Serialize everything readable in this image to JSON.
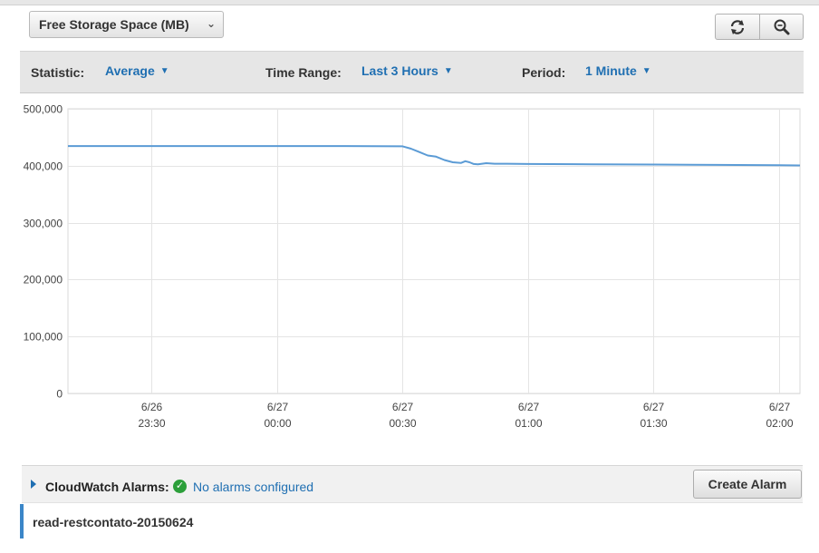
{
  "metric_select": {
    "label": "Free Storage Space (MB)",
    "caret": "⌄"
  },
  "toolbar": {
    "statistic_label": "Statistic:",
    "statistic_value": "Average",
    "time_range_label": "Time Range:",
    "time_range_value": "Last 3 Hours",
    "period_label": "Period:",
    "period_value": "1 Minute",
    "chevron": "▼"
  },
  "icons": {
    "refresh": "refresh-icon",
    "zoom": "zoom-icon",
    "expand": "expand-triangle-icon",
    "check": "check-circle-icon"
  },
  "colors": {
    "line": "#5b9bd5",
    "link": "#1f6fb2",
    "ok": "#2c9f3a",
    "accent_bar": "#3b86c8"
  },
  "chart_data": {
    "type": "line",
    "title": "",
    "xlabel": "",
    "ylabel": "",
    "ylim": [
      0,
      500000
    ],
    "yticks": [
      0,
      100000,
      200000,
      300000,
      400000,
      500000
    ],
    "ytick_labels": [
      "0",
      "100,000",
      "200,000",
      "300,000",
      "400,000",
      "500,000"
    ],
    "xlim": [
      "23:10",
      "02:05"
    ],
    "xticks": [
      {
        "time": "23:30",
        "date": "6/26"
      },
      {
        "time": "00:00",
        "date": "6/27"
      },
      {
        "time": "00:30",
        "date": "6/27"
      },
      {
        "time": "01:00",
        "date": "6/27"
      },
      {
        "time": "01:30",
        "date": "6/27"
      },
      {
        "time": "02:00",
        "date": "6/27"
      }
    ],
    "grid": true,
    "series": [
      {
        "x": [
          "23:10",
          "23:30",
          "00:00",
          "00:15",
          "00:30",
          "00:32",
          "00:34",
          "00:36",
          "00:38",
          "00:40",
          "00:42",
          "00:44",
          "00:45",
          "00:46",
          "00:47",
          "00:48",
          "00:50",
          "00:52",
          "00:55",
          "01:00",
          "01:15",
          "01:30",
          "01:45",
          "02:00",
          "02:05"
        ],
        "values": [
          434500,
          434500,
          434500,
          434500,
          434000,
          430000,
          424000,
          418000,
          416000,
          410000,
          406000,
          405000,
          408000,
          406000,
          403000,
          402500,
          404500,
          403500,
          403500,
          403000,
          402500,
          402000,
          401500,
          401000,
          400500
        ]
      }
    ]
  },
  "alarms": {
    "label": "CloudWatch Alarms:",
    "status": "No alarms configured",
    "check": "✓"
  },
  "create_alarm_label": "Create Alarm",
  "instance_name": "read-restcontato-20150624"
}
